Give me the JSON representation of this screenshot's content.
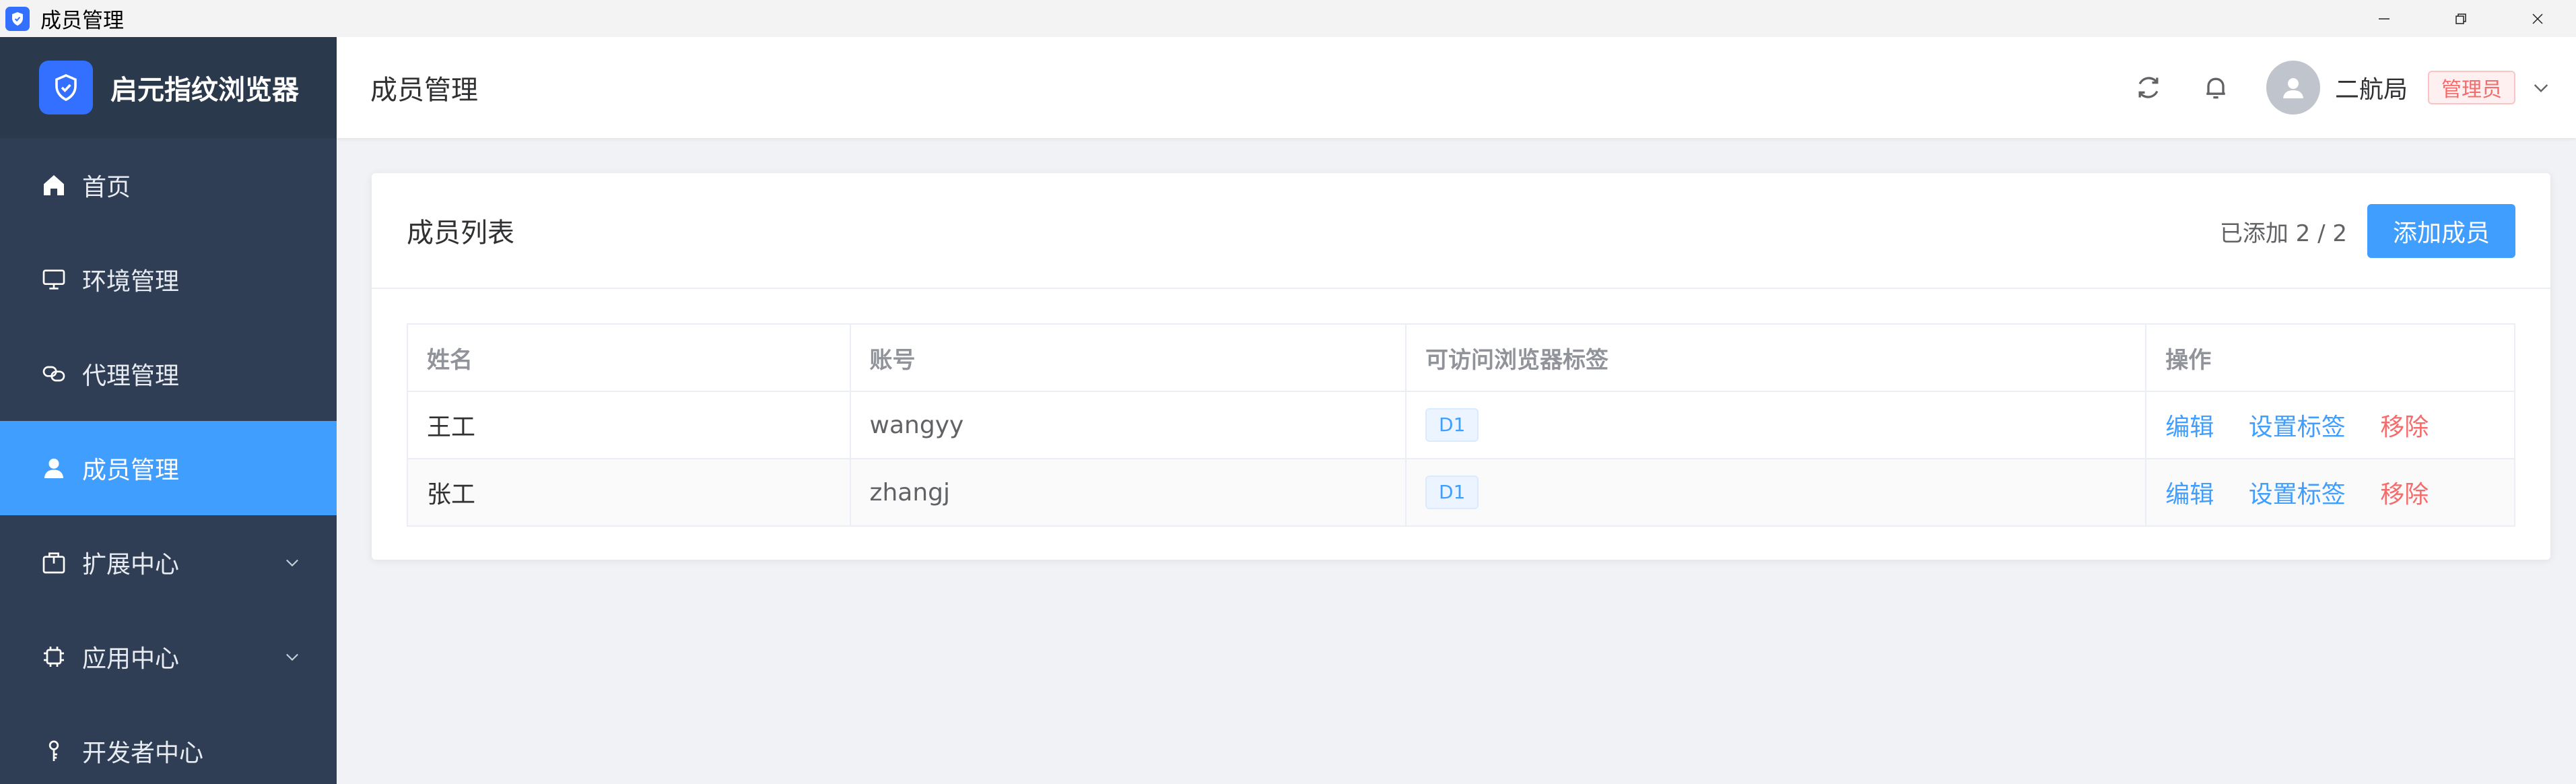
{
  "window": {
    "title": "成员管理",
    "controls": [
      "minimize",
      "restore",
      "close"
    ]
  },
  "sidebar": {
    "brand": "启元指纹浏览器",
    "items": [
      {
        "label": "首页",
        "icon": "home-icon",
        "active": false,
        "expandable": false
      },
      {
        "label": "环境管理",
        "icon": "monitor-icon",
        "active": false,
        "expandable": false
      },
      {
        "label": "代理管理",
        "icon": "link-icon",
        "active": false,
        "expandable": false
      },
      {
        "label": "成员管理",
        "icon": "user-icon",
        "active": true,
        "expandable": false
      },
      {
        "label": "扩展中心",
        "icon": "package-icon",
        "active": false,
        "expandable": true
      },
      {
        "label": "应用中心",
        "icon": "chip-icon",
        "active": false,
        "expandable": true
      },
      {
        "label": "开发者中心",
        "icon": "key-icon",
        "active": false,
        "expandable": false
      }
    ]
  },
  "header": {
    "page_title": "成员管理",
    "username": "二航局",
    "role": "管理员"
  },
  "card": {
    "title": "成员列表",
    "added_count": "已添加 2 / 2",
    "add_button": "添加成员",
    "columns": [
      "姓名",
      "账号",
      "可访问浏览器标签",
      "操作"
    ],
    "rows": [
      {
        "name": "王工",
        "account": "wangyy",
        "tag": "D1",
        "actions": [
          "编辑",
          "设置标签",
          "移除"
        ]
      },
      {
        "name": "张工",
        "account": "zhangj",
        "tag": "D1",
        "actions": [
          "编辑",
          "设置标签",
          "移除"
        ]
      }
    ]
  },
  "colors": {
    "primary": "#409eff",
    "sidebar_bg": "#2f3e54",
    "danger": "#f56c6c",
    "brand_blue": "#3370ff"
  }
}
